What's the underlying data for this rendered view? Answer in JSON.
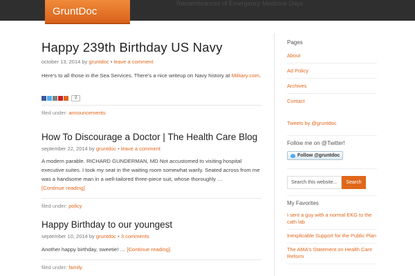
{
  "site": {
    "logo": "GruntDoc",
    "tagline": "Remembrances of Emergency Medicine Days"
  },
  "posts": [
    {
      "title": "Happy 239th Birthday US Navy",
      "date": "october 13, 2014",
      "by": "by",
      "author": "gruntdoc",
      "dot": "•",
      "comments": "leave a comment",
      "excerpt": "Here's to all those in the Sea Services. There's a nice writeup on Navy history at",
      "excerpt_link": "Military.com",
      "excerpt_end": ".",
      "share_count": "2",
      "filed_label": "filed under:",
      "category": "announcements"
    },
    {
      "title": "How To Discourage a Doctor | The Health Care Blog",
      "date": "september 22, 2014",
      "by": "by",
      "author": "gruntdoc",
      "dot": "•",
      "comments": "leave a comment",
      "excerpt": "A modern parable. RICHARD GUNDERMAN, MD Not accustomed to visiting hospital executive suites. I took my seat in the waiting room somewhat warily. Seated across from me was a handsome man in a well-tailored three-piece suit, whose thoroughly …",
      "read_more": "[Continue reading]",
      "filed_label": "filed under:",
      "category": "policy"
    },
    {
      "title": "Happy Birthday to our youngest",
      "date": "september 10, 2014",
      "by": "by",
      "author": "gruntdoc",
      "dot": "•",
      "comments": "3 comments",
      "excerpt": "Another happy birthday, sweetie! …",
      "read_more": "[Continue reading]",
      "filed_label": "filed under:",
      "category": "family"
    }
  ],
  "sidebar": {
    "pages_title": "Pages",
    "pages": [
      "About",
      "Ad Policy",
      "Archives",
      "Contact"
    ],
    "tweets_link": "Tweets by @gruntdoc",
    "follow_title": "Follow me on @Twitter!",
    "follow_button": "Follow @gruntdoc",
    "search_placeholder": "Search this website...",
    "search_button": "Search",
    "favorites_title": "My Favorites",
    "favorites": [
      "I sent a guy with a normal EKG to the cath lab",
      "Inexplicable Support for the Public Plan",
      "The AMA's Statement on Health Care Reform"
    ]
  },
  "colors": {
    "accent": "#e0671b",
    "topbar": "#2f2f2f",
    "share_icons": [
      "#3b5998",
      "#55acee",
      "#7f7f7f",
      "#cb2027",
      "#e0671b"
    ]
  },
  "icons": [
    "facebook-icon",
    "twitter-icon",
    "email-icon",
    "pinterest-icon",
    "plus-icon",
    "twitter-bird-icon"
  ]
}
